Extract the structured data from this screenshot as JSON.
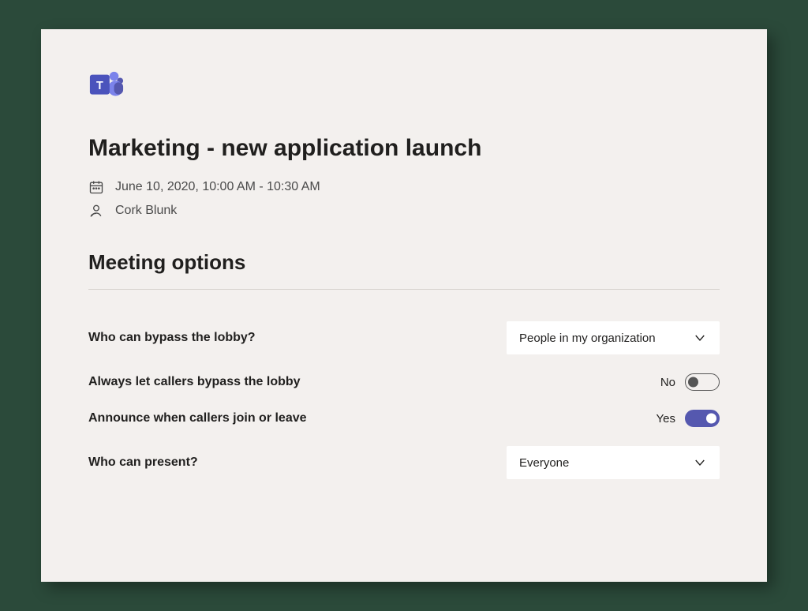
{
  "meeting": {
    "title": "Marketing - new application launch",
    "datetime": "June 10, 2020, 10:00 AM - 10:30 AM",
    "organizer": "Cork Blunk"
  },
  "section": {
    "title": "Meeting options"
  },
  "options": {
    "bypass_lobby": {
      "label": "Who can bypass the lobby?",
      "value": "People in my organization"
    },
    "callers_bypass": {
      "label": "Always let callers bypass the lobby",
      "state_text": "No"
    },
    "announce": {
      "label": "Announce when callers join or leave",
      "state_text": "Yes"
    },
    "present": {
      "label": "Who can present?",
      "value": "Everyone"
    }
  }
}
